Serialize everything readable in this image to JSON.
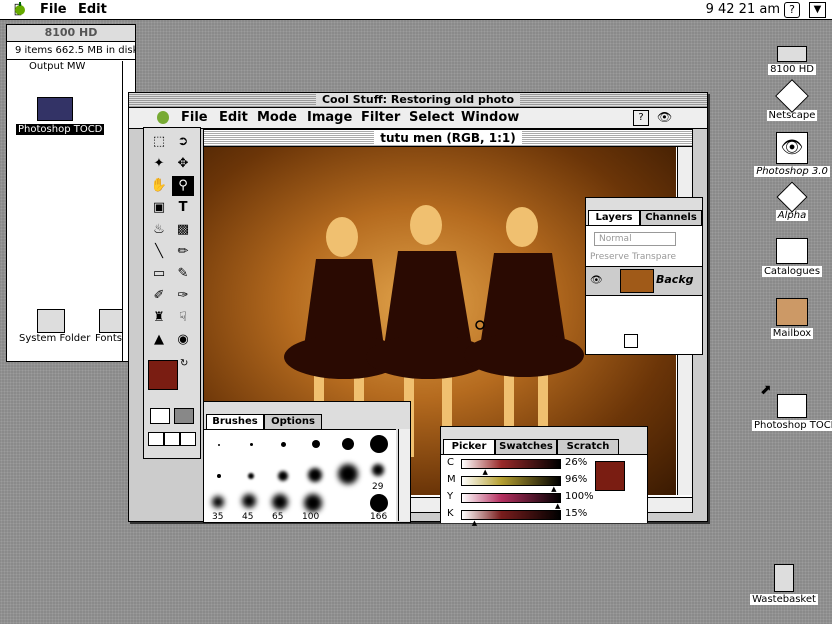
{
  "menubar": {
    "apple": "",
    "items": [
      "File",
      "Edit"
    ],
    "clock": "9 42 21 am"
  },
  "finder": {
    "title": "8100 HD",
    "info": "9 items   662.5 MB in disk",
    "items": [
      {
        "label": "Output MW"
      },
      {
        "label": "Photoshop TOCD"
      },
      {
        "label": "System Folder"
      },
      {
        "label": "Fonts"
      }
    ]
  },
  "desktop_icons": [
    {
      "label": "8100 HD"
    },
    {
      "label": "Netscape"
    },
    {
      "label": "Photoshop 3.0"
    },
    {
      "label": "Alpha"
    },
    {
      "label": "Catalogues"
    },
    {
      "label": "Mailbox"
    },
    {
      "label": "Photoshop TOCD"
    },
    {
      "label": "Wastebasket"
    }
  ],
  "photoshop": {
    "window_title": "Cool Stuff: Restoring old photo",
    "menu": [
      "File",
      "Edit",
      "Mode",
      "Image",
      "Filter",
      "Select",
      "Window"
    ],
    "doc_title": "tutu men (RGB, 1:1)"
  },
  "brushes": {
    "tabs": [
      "Brushes",
      "Options"
    ],
    "numbers": [
      "29",
      "35",
      "45",
      "65",
      "100",
      "166"
    ]
  },
  "layers": {
    "tabs": [
      "Layers",
      "Channels"
    ],
    "mode": "Normal",
    "preserve": "Preserve Transpare",
    "layer_name": "Backg"
  },
  "picker": {
    "tabs": [
      "Picker",
      "Swatches",
      "Scratch"
    ],
    "rows": [
      {
        "label": "C",
        "value": "26%",
        "level": 0.26,
        "color": "#9a2a2a"
      },
      {
        "label": "M",
        "value": "96%",
        "level": 0.96,
        "color": "#b5a032"
      },
      {
        "label": "Y",
        "value": "100%",
        "level": 1.0,
        "color": "#b53060"
      },
      {
        "label": "K",
        "value": "15%",
        "level": 0.15,
        "color": "#7a1d1d"
      }
    ],
    "foreground": "#7a1d12"
  }
}
